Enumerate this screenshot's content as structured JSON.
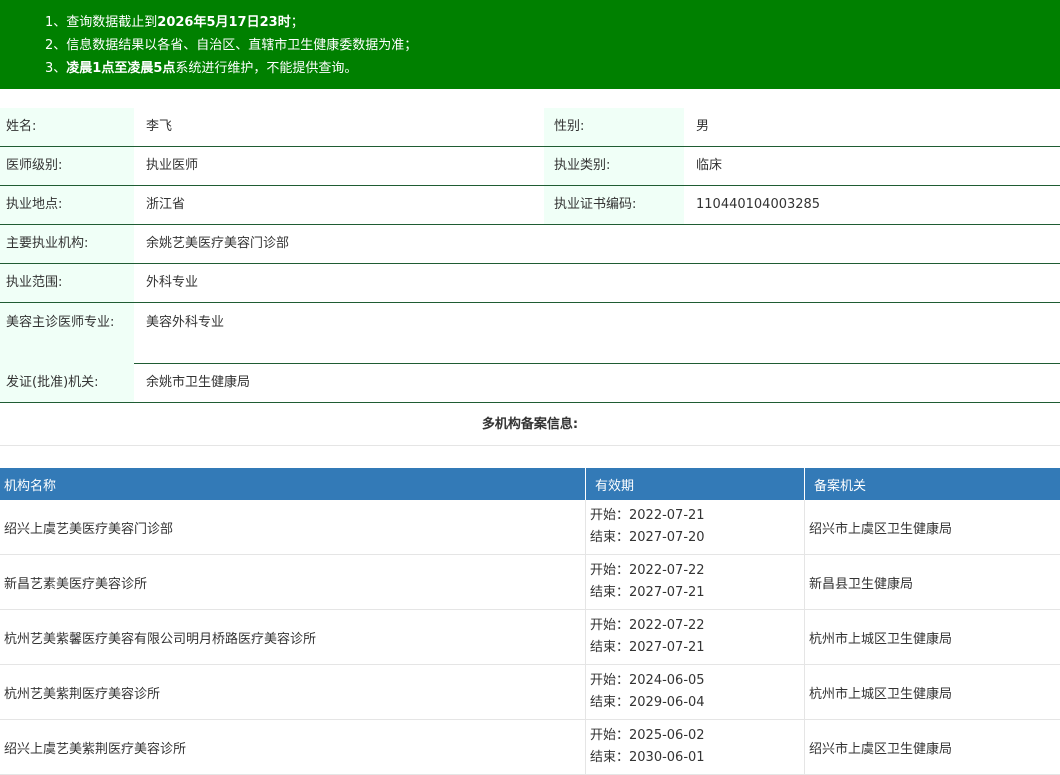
{
  "notice": {
    "line1_pre": "1、查询数据截止到",
    "line1_bold": "2026年5月17日23时",
    "line1_post": "；",
    "line2": "2、信息数据结果以各省、自治区、直辖市卫生健康委数据为准；",
    "line3_pre": "3、",
    "line3_bold": "凌晨1点至凌晨5点",
    "line3_post": "系统进行维护，不能提供查询。"
  },
  "info": {
    "name_label": "姓名:",
    "name_value": "李飞",
    "gender_label": "性别:",
    "gender_value": "男",
    "level_label": "医师级别:",
    "level_value": "执业医师",
    "category_label": "执业类别:",
    "category_value": "临床",
    "location_label": "执业地点:",
    "location_value": "浙江省",
    "cert_label": "执业证书编码:",
    "cert_value": "110440104003285",
    "institution_label": "主要执业机构:",
    "institution_value": "余姚艺美医疗美容门诊部",
    "scope_label": "执业范围:",
    "scope_value": "外科专业",
    "cosmetic_label": "美容主诊医师专业:",
    "cosmetic_value": "美容外科专业",
    "issuer_label": "发证(批准)机关:",
    "issuer_value": "余姚市卫生健康局"
  },
  "section_title": "多机构备案信息:",
  "table": {
    "headers": [
      "机构名称",
      "有效期",
      "备案机关"
    ],
    "rows": [
      {
        "name": "绍兴上虞艺美医疗美容门诊部",
        "start": "开始：2022-07-21",
        "end": "结束：2027-07-20",
        "authority": "绍兴市上虞区卫生健康局"
      },
      {
        "name": "新昌艺素美医疗美容诊所",
        "start": "开始：2022-07-22",
        "end": "结束：2027-07-21",
        "authority": "新昌县卫生健康局"
      },
      {
        "name": "杭州艺美紫馨医疗美容有限公司明月桥路医疗美容诊所",
        "start": "开始：2022-07-22",
        "end": "结束：2027-07-21",
        "authority": "杭州市上城区卫生健康局"
      },
      {
        "name": "杭州艺美紫荆医疗美容诊所",
        "start": "开始：2024-06-05",
        "end": "结束：2029-06-04",
        "authority": "杭州市上城区卫生健康局"
      },
      {
        "name": "绍兴上虞艺美紫荆医疗美容诊所",
        "start": "开始：2025-06-02",
        "end": "结束：2030-06-01",
        "authority": "绍兴市上虞区卫生健康局"
      }
    ]
  },
  "colors": {
    "notice_bg": "#008000",
    "header_bg": "#337ab7",
    "label_bg": "#f0fff7"
  }
}
